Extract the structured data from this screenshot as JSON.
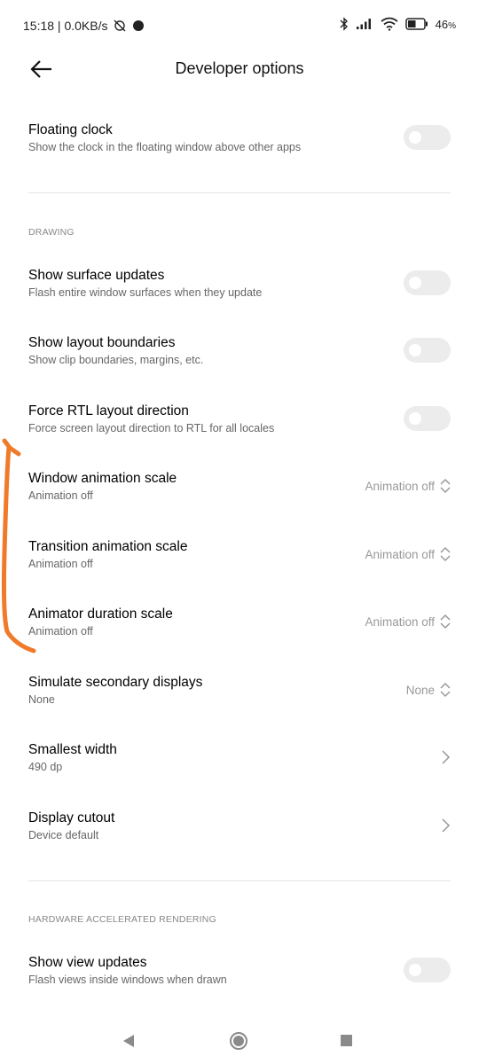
{
  "status_bar": {
    "time_speed": "15:18 | 0.0KB/s",
    "battery": "46",
    "battery_unit": "%"
  },
  "header": {
    "title": "Developer options"
  },
  "rows": {
    "floating_clock": {
      "title": "Floating clock",
      "subtitle": "Show the clock in the floating window above other apps",
      "enabled": false
    },
    "show_surface_updates": {
      "title": "Show surface updates",
      "subtitle": "Flash entire window surfaces when they update",
      "enabled": false
    },
    "show_layout_boundaries": {
      "title": "Show layout boundaries",
      "subtitle": "Show clip boundaries, margins, etc.",
      "enabled": false
    },
    "force_rtl": {
      "title": "Force RTL layout direction",
      "subtitle": "Force screen layout direction to RTL for all locales",
      "enabled": false
    },
    "window_animation": {
      "title": "Window animation scale",
      "subtitle": "Animation off",
      "value": "Animation off"
    },
    "transition_animation": {
      "title": "Transition animation scale",
      "subtitle": "Animation off",
      "value": "Animation off"
    },
    "animator_duration": {
      "title": "Animator duration scale",
      "subtitle": "Animation off",
      "value": "Animation off"
    },
    "simulate_secondary": {
      "title": "Simulate secondary displays",
      "subtitle": "None",
      "value": "None"
    },
    "smallest_width": {
      "title": "Smallest width",
      "subtitle": "490 dp"
    },
    "display_cutout": {
      "title": "Display cutout",
      "subtitle": "Device default"
    },
    "show_view_updates": {
      "title": "Show view updates",
      "subtitle": "Flash views inside windows when drawn",
      "enabled": false
    }
  },
  "sections": {
    "drawing": "DRAWING",
    "hardware": "HARDWARE ACCELERATED RENDERING"
  },
  "colors": {
    "toggle_off": "#ececec",
    "annotation": "#f07a2a",
    "secondary_text": "#666666",
    "value_text": "#999999"
  }
}
